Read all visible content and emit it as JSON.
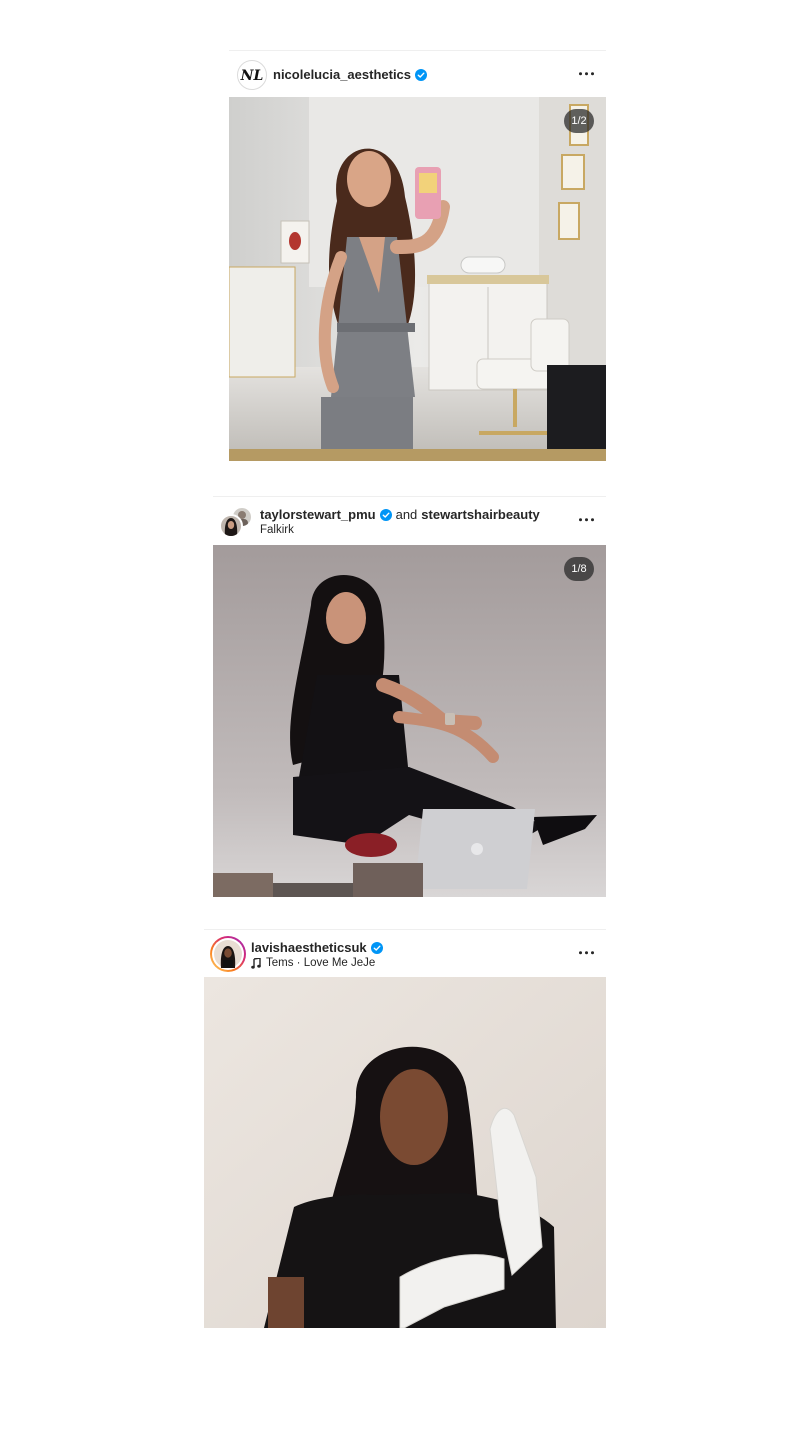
{
  "posts": [
    {
      "username": "nicolelucia_aesthetics",
      "verified": true,
      "avatar_text": "NL",
      "counter": "1/2",
      "more_icon": "more-horizontal-icon"
    },
    {
      "username": "taylorstewart_pmu",
      "verified": true,
      "and_text": "and",
      "collaborator": "stewartshairbeauty",
      "location": "Falkirk",
      "counter": "1/8",
      "more_icon": "more-horizontal-icon"
    },
    {
      "username": "lavishaestheticsuk",
      "verified": true,
      "music": "Tems · Love Me JeJe",
      "more_icon": "more-horizontal-icon"
    }
  ],
  "colors": {
    "verified_blue": "#0095f6",
    "story_ring_start": "#feda75",
    "story_ring_end": "#d62976",
    "divider": "#efefef"
  }
}
